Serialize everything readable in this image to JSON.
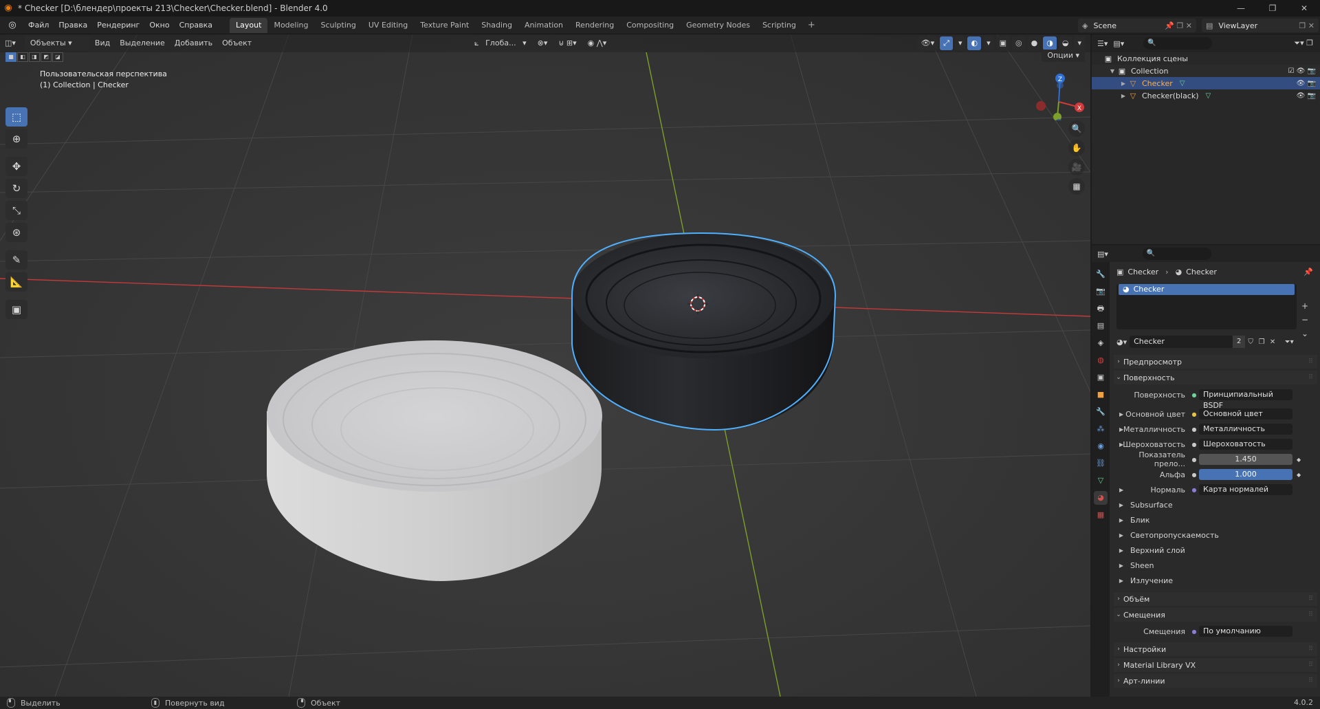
{
  "window": {
    "title": "* Checker [D:\\блендер\\проекты 213\\Checker\\Checker.blend] - Blender 4.0",
    "controls": [
      "—",
      "❐",
      "✕"
    ]
  },
  "menu": [
    "Файл",
    "Правка",
    "Рендеринг",
    "Окно",
    "Справка"
  ],
  "workspaces": [
    "Layout",
    "Modeling",
    "Sculpting",
    "UV Editing",
    "Texture Paint",
    "Shading",
    "Animation",
    "Rendering",
    "Compositing",
    "Geometry Nodes",
    "Scripting"
  ],
  "active_workspace": "Layout",
  "scene": "Scene",
  "view_layer": "ViewLayer",
  "viewport": {
    "mode": "Объекты",
    "header_menus": [
      "Вид",
      "Выделение",
      "Добавить",
      "Объект"
    ],
    "orientation": "Глоба...",
    "options": "Опции",
    "info_line1": "Пользовательская перспектива",
    "info_line2": "(1) Collection | Checker",
    "gizmo_z": "Z",
    "gizmo_x": "X"
  },
  "outliner": {
    "root": "Коллекция сцены",
    "collection": "Collection",
    "objects": [
      {
        "name": "Checker",
        "selected": true
      },
      {
        "name": "Checker(black)",
        "selected": false
      }
    ]
  },
  "properties": {
    "breadcrumb_object": "Checker",
    "breadcrumb_material": "Checker",
    "slot": "Checker",
    "material_name": "Checker",
    "users": "2",
    "panels": {
      "preview": "Предпросмотр",
      "surface": "Поверхность",
      "volume": "Объём",
      "displacement": "Смещения",
      "settings": "Настройки",
      "library": "Material Library VX",
      "lineart": "Арт-линии"
    },
    "surface_label": "Поверхность",
    "surface_value": "Принципиальный BSDF",
    "rows": [
      {
        "label": "Основной цвет",
        "value": "Основной цвет"
      },
      {
        "label": "Металличность",
        "value": "Металличность"
      },
      {
        "label": "Шероховатость",
        "value": "Шероховатость"
      },
      {
        "label": "Показатель прело...",
        "value": "1.450"
      },
      {
        "label": "Альфа",
        "value": "1.000"
      },
      {
        "label": "Нормаль",
        "value": "Карта нормалей"
      }
    ],
    "subpanels": [
      "Subsurface",
      "Блик",
      "Светопропускаемость",
      "Верхний слой",
      "Sheen",
      "Излучение"
    ],
    "displacement_label": "Смещения",
    "displacement_value": "По умолчанию"
  },
  "status": {
    "select": "Выделить",
    "rotate": "Повернуть вид",
    "object": "Объект",
    "version": "4.0.2"
  },
  "colors": {
    "accent": "#4772b3",
    "selection_outline": "#4fb0ff",
    "axis_x": "#c43a3a",
    "axis_y": "#7ca02a"
  }
}
